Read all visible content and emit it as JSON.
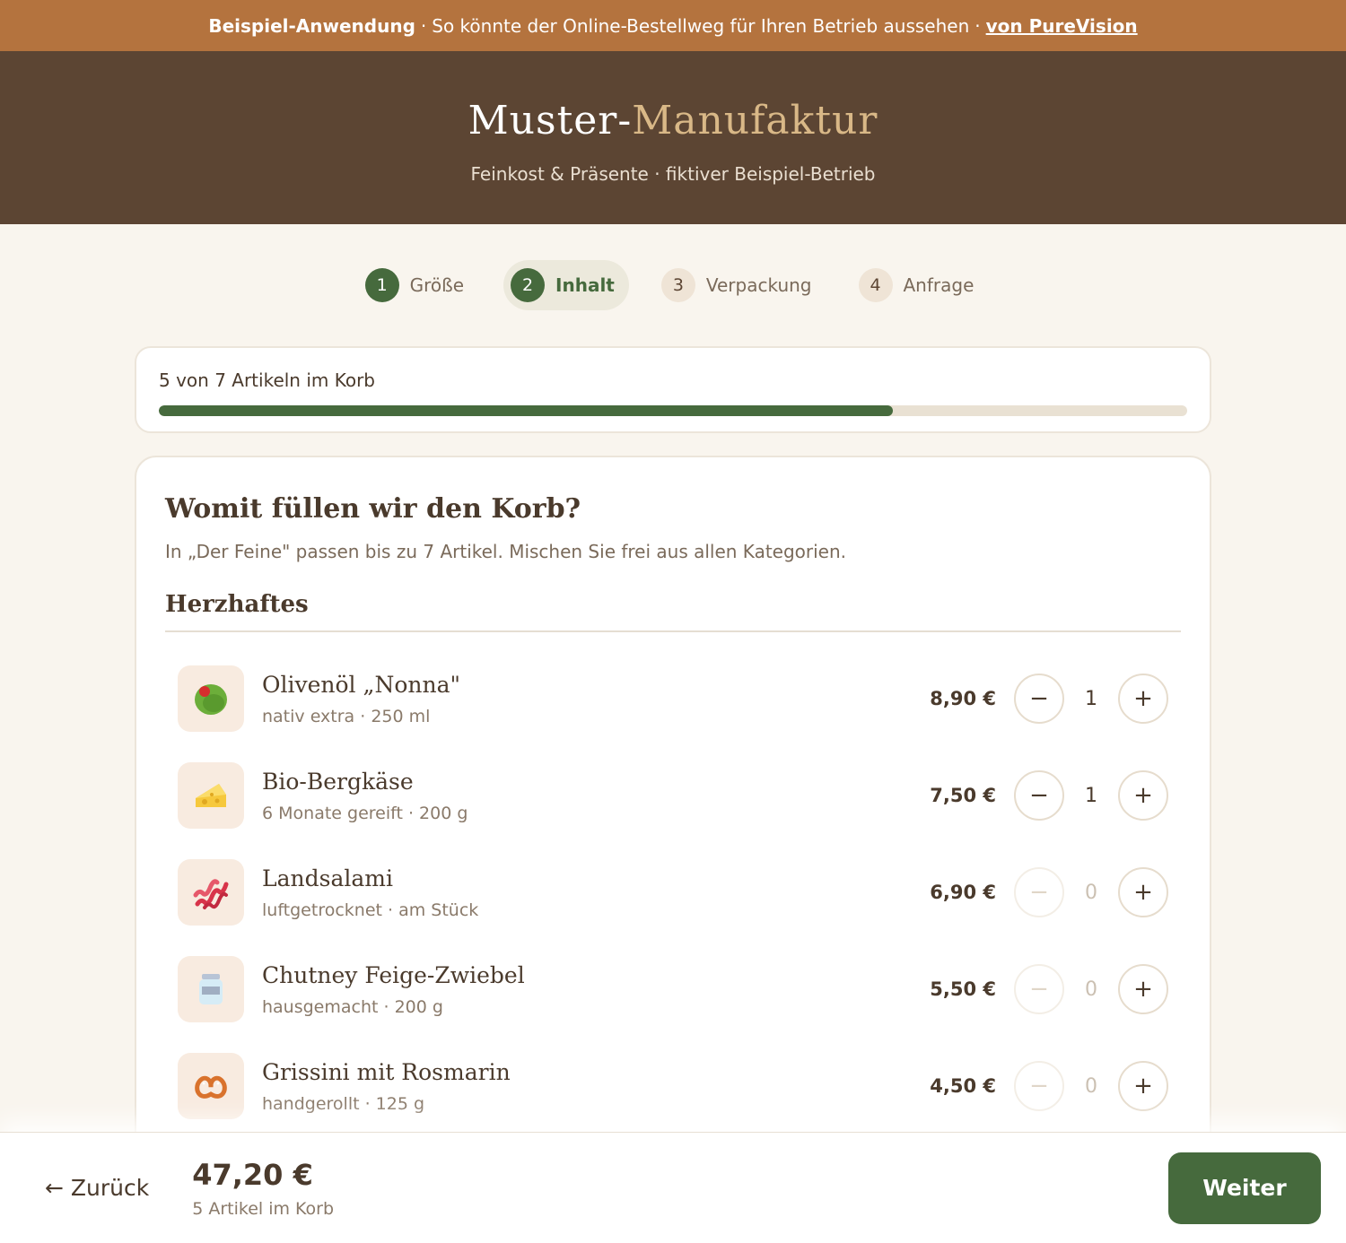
{
  "banner": {
    "bold": "Beispiel-Anwendung",
    "sep1": "·",
    "text": "So könnte der Online-Bestellweg für Ihren Betrieb aussehen",
    "sep2": "·",
    "link": "von PureVision"
  },
  "header": {
    "brand_part1": "Muster-",
    "brand_part2": "Manufaktur",
    "tagline": "Feinkost & Präsente · fiktiver Beispiel-Betrieb"
  },
  "steps": [
    {
      "num": "1",
      "label": "Größe",
      "state": "done"
    },
    {
      "num": "2",
      "label": "Inhalt",
      "state": "active"
    },
    {
      "num": "3",
      "label": "Verpackung",
      "state": "todo"
    },
    {
      "num": "4",
      "label": "Anfrage",
      "state": "todo"
    }
  ],
  "progress": {
    "text": "5 von 7 Artikeln im Korb",
    "fraction": 0.714
  },
  "content": {
    "title": "Womit füllen wir den Korb?",
    "subtitle": "In „Der Feine\" passen bis zu 7 Artikel. Mischen Sie frei aus allen Kategorien.",
    "category": "Herzhaftes",
    "minus": "−",
    "plus": "+",
    "items": [
      {
        "name": "Olivenöl „Nonna\"",
        "desc": "nativ extra · 250 ml",
        "price": "8,90 €",
        "qty": "1",
        "icon": "olive-icon"
      },
      {
        "name": "Bio-Bergkäse",
        "desc": "6 Monate gereift · 200 g",
        "price": "7,50 €",
        "qty": "1",
        "icon": "cheese-icon"
      },
      {
        "name": "Landsalami",
        "desc": "luftgetrocknet · am Stück",
        "price": "6,90 €",
        "qty": "0",
        "icon": "bacon-icon"
      },
      {
        "name": "Chutney Feige-Zwiebel",
        "desc": "hausgemacht · 200 g",
        "price": "5,50 €",
        "qty": "0",
        "icon": "jar-icon"
      },
      {
        "name": "Grissini mit Rosmarin",
        "desc": "handgerollt · 125 g",
        "price": "4,50 €",
        "qty": "0",
        "icon": "pretzel-icon"
      }
    ]
  },
  "footer": {
    "back": "← Zurück",
    "total": "47,20 €",
    "count": "5 Artikel im Korb",
    "next": "Weiter"
  },
  "colors": {
    "accent_green": "#466a3d",
    "banner_orange": "#b4733e",
    "header_brown": "#5c4533",
    "brand_gold": "#d9b887"
  }
}
